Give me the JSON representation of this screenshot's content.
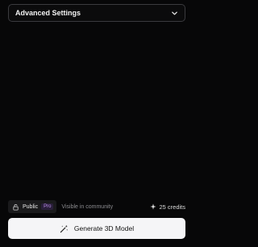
{
  "advanced_settings": {
    "title": "Advanced Settings",
    "expand_icon": "chevron-down-icon"
  },
  "visibility": {
    "icon": "lock-icon",
    "label": "Public",
    "badge": "Pro",
    "description": "Visible in community"
  },
  "credits": {
    "icon": "sparkle-icon",
    "text": "25 credits"
  },
  "generate_button": {
    "icon": "magic-wand-icon",
    "label": "Generate 3D Model"
  },
  "colors": {
    "background": "#070708",
    "button_bg": "#f5f5f7",
    "pro_badge": "#b88be8"
  }
}
